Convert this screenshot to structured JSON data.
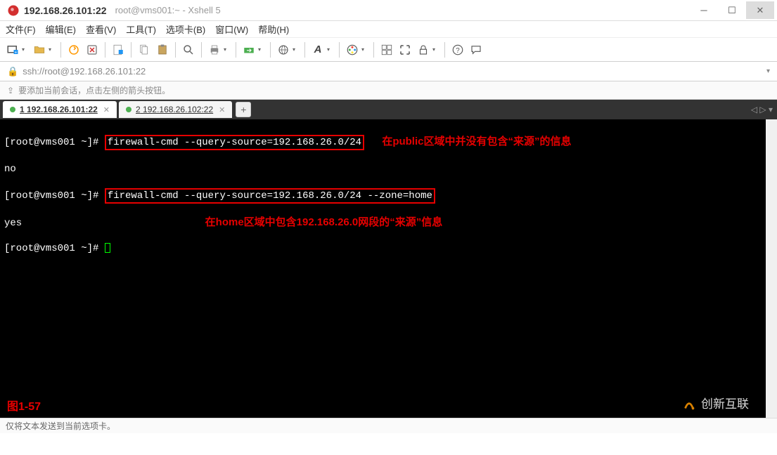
{
  "window": {
    "title_bold": "192.168.26.101:22",
    "title_sub": "root@vms001:~ - Xshell 5"
  },
  "menu": {
    "file": "文件(F)",
    "edit": "编辑(E)",
    "view": "查看(V)",
    "tools": "工具(T)",
    "tabs": "选项卡(B)",
    "window": "窗口(W)",
    "help": "帮助(H)"
  },
  "address": {
    "url": "ssh://root@192.168.26.101:22"
  },
  "hint": {
    "text": "要添加当前会话，点击左侧的箭头按钮。"
  },
  "tabs": [
    {
      "index": "1",
      "label": "192.168.26.101:22",
      "active": true
    },
    {
      "index": "2",
      "label": "192.168.26.102:22",
      "active": false
    }
  ],
  "term": {
    "line1_prompt": "[root@vms001 ~]# ",
    "line1_cmd": "firewall-cmd --query-source=192.168.26.0/24",
    "line1_note": "在public区域中并没有包含“来源”的信息",
    "line2": "no",
    "line3_prompt": "[root@vms001 ~]# ",
    "line3_cmd": "firewall-cmd --query-source=192.168.26.0/24 --zone=home",
    "line4": "yes",
    "line4_note": "在home区域中包含192.168.26.0网段的“来源”信息",
    "line5_prompt": "[root@vms001 ~]# ",
    "fig": "图1-57",
    "watermark": "创新互联"
  },
  "status": {
    "text": "仅将文本发送到当前选项卡。"
  }
}
